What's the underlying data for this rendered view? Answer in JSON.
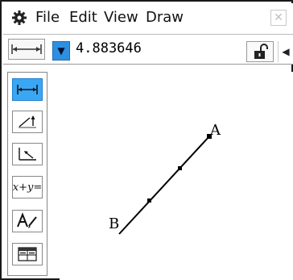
{
  "menubar": {
    "gear_icon": "gear-icon",
    "items": [
      "File",
      "Edit",
      "View",
      "Draw"
    ],
    "close_icon": "close-icon"
  },
  "toolbar": {
    "measure_icon": "length-measure-icon",
    "dropdown_icon": "dropdown-arrow-icon",
    "measurement_value": "4.883646",
    "lock_icon": "unlock-icon",
    "scroll_icon": "scroll-left-icon"
  },
  "palette": {
    "tools": [
      {
        "icon": "length-icon",
        "active": true
      },
      {
        "icon": "direction-icon",
        "active": false
      },
      {
        "icon": "angle-icon",
        "active": false
      },
      {
        "icon": "equation-icon",
        "text": "x+y=",
        "active": false
      },
      {
        "icon": "text-label-icon",
        "active": false
      },
      {
        "icon": "table-icon",
        "active": false
      }
    ]
  },
  "canvas": {
    "labels": [
      "A",
      "B"
    ]
  },
  "colors": {
    "accent": "#3aa7f5",
    "dropdown": "#2e8fe0",
    "frame": "#1a1a1a"
  }
}
